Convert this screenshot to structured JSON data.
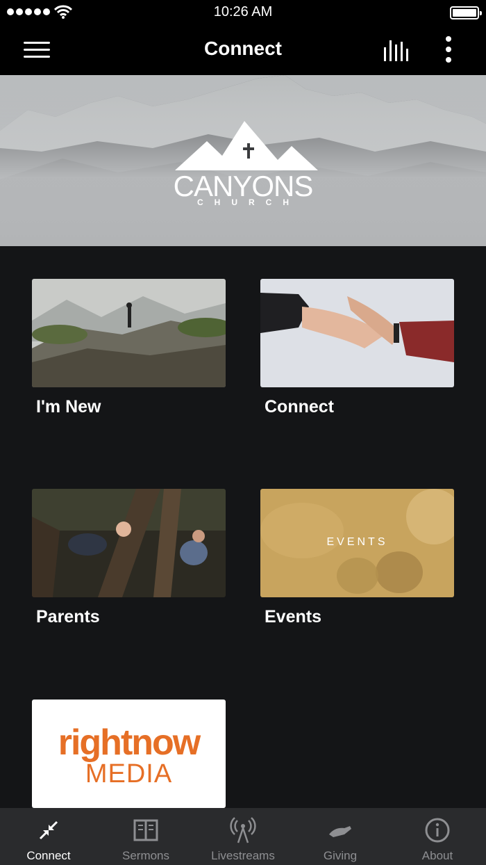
{
  "status_bar": {
    "time": "10:26 AM"
  },
  "nav": {
    "title": "Connect"
  },
  "hero": {
    "title": "CANYONS",
    "subtitle": "CHURCH"
  },
  "tiles": [
    {
      "label": "I'm New"
    },
    {
      "label": "Connect"
    },
    {
      "label": "Parents"
    },
    {
      "label": "Events",
      "overlay_text": "EVENTS"
    },
    {
      "label": "",
      "logo_top": "rightnow",
      "logo_bottom": "MEDIA"
    }
  ],
  "tab_bar": {
    "items": [
      {
        "label": "Connect",
        "icon": "connect-icon",
        "active": true
      },
      {
        "label": "Sermons",
        "icon": "book-icon",
        "active": false
      },
      {
        "label": "Livestreams",
        "icon": "broadcast-icon",
        "active": false
      },
      {
        "label": "Giving",
        "icon": "giving-hand-icon",
        "active": false
      },
      {
        "label": "About",
        "icon": "info-icon",
        "active": false
      }
    ]
  },
  "colors": {
    "background": "#141517",
    "tab_bar": "#2a2b2d",
    "accent_brand": "#e66f26",
    "inactive": "#8e8f92"
  }
}
